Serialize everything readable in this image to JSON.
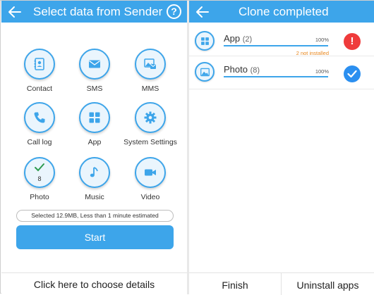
{
  "sender": {
    "title": "Select data from Sender",
    "help_label": "?",
    "categories": [
      {
        "label": "Contact",
        "icon": "contact-book-icon"
      },
      {
        "label": "SMS",
        "icon": "envelope-icon"
      },
      {
        "label": "MMS",
        "icon": "mms-icon"
      },
      {
        "label": "Call log",
        "icon": "phone-icon"
      },
      {
        "label": "App",
        "icon": "app-grid-icon"
      },
      {
        "label": "System Settings",
        "icon": "gear-icon"
      },
      {
        "label": "Photo",
        "icon": "checkmark-icon",
        "count": "8"
      },
      {
        "label": "Music",
        "icon": "music-note-icon"
      },
      {
        "label": "Video",
        "icon": "video-camera-icon"
      }
    ],
    "estimate": "Selected 12.9MB, Less than 1 minute estimated",
    "start_label": "Start",
    "details_link": "Click here to choose details"
  },
  "clone": {
    "title": "Clone completed",
    "items": [
      {
        "name": "App",
        "count": "(2)",
        "percent": "100%",
        "progress": 1.0,
        "warning": "2 not installed",
        "status": "error",
        "status_glyph": "!"
      },
      {
        "name": "Photo",
        "count": "(8)",
        "percent": "100%",
        "progress": 1.0,
        "warning": "",
        "status": "success"
      }
    ],
    "finish_label": "Finish",
    "uninstall_label": "Uninstall apps"
  },
  "colors": {
    "accent": "#3da5ea",
    "error": "#ef3b3b",
    "success": "#2b8ff0",
    "warning": "#e8871e"
  }
}
